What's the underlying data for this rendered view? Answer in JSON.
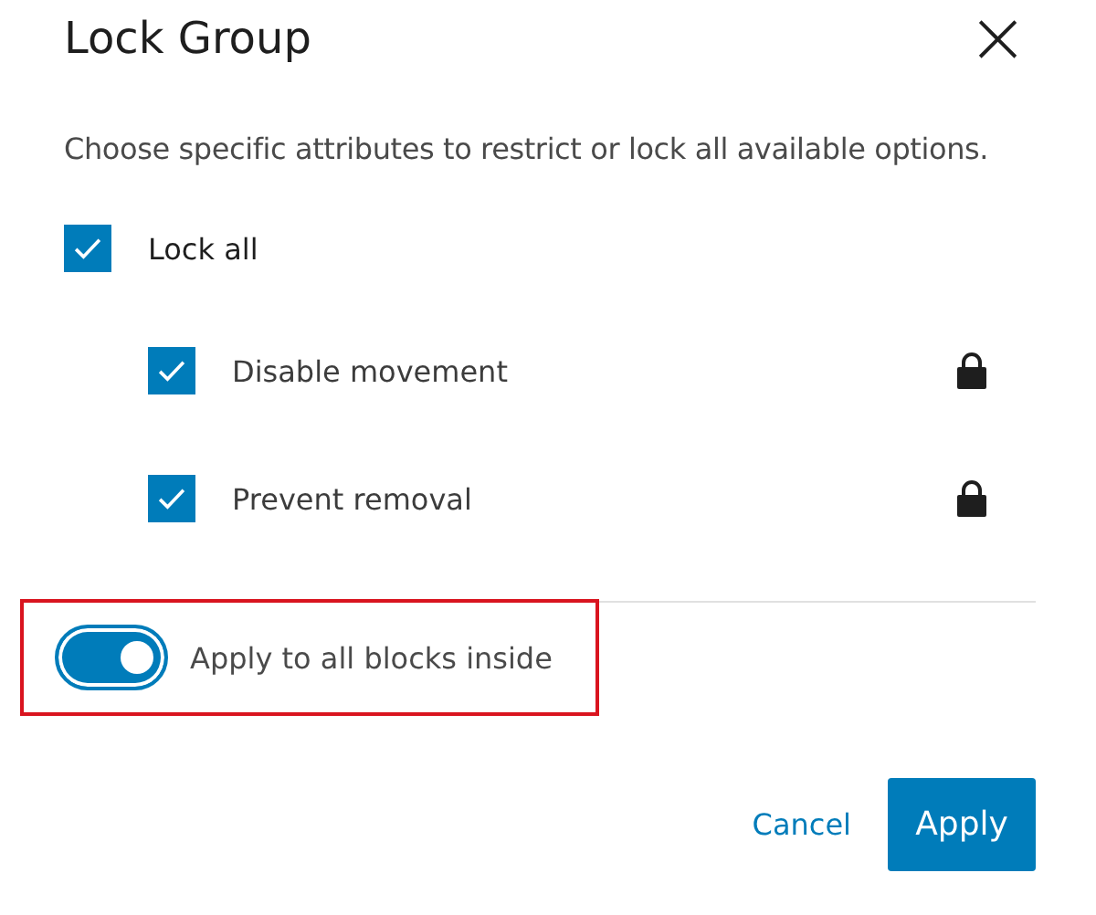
{
  "dialog": {
    "title": "Lock Group",
    "close_label": "×",
    "description": "Choose specific attributes to restrict or lock all available options."
  },
  "lock_all": {
    "label": "Lock all",
    "checked": true
  },
  "options": [
    {
      "label": "Disable movement",
      "checked": true,
      "locked": true
    },
    {
      "label": "Prevent removal",
      "checked": true,
      "locked": true
    }
  ],
  "apply_inside": {
    "label": "Apply to all blocks inside",
    "on": true,
    "highlighted": true
  },
  "buttons": [
    {
      "label": "Cancel",
      "kind": "link"
    },
    {
      "label": "Apply",
      "kind": "primary"
    }
  ]
}
